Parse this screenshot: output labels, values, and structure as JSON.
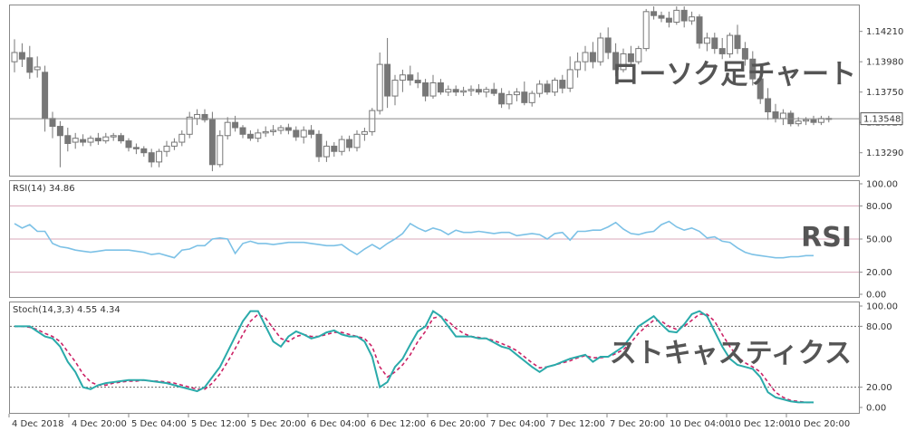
{
  "chart_data": [
    {
      "type": "candlestick",
      "overlay_label": "ローソク足チャート",
      "y_ticks": [
        "1.14210",
        "1.13980",
        "1.13750",
        "1.13520",
        "1.13290"
      ],
      "ylim": [
        1.1313,
        1.144
      ],
      "current_price": "1.13548",
      "current_price_value": 1.13548,
      "candles": [
        {
          "o": 1.1398,
          "h": 1.1415,
          "l": 1.139,
          "c": 1.1405
        },
        {
          "o": 1.1405,
          "h": 1.1412,
          "l": 1.1394,
          "c": 1.14
        },
        {
          "o": 1.1401,
          "h": 1.141,
          "l": 1.1385,
          "c": 1.139
        },
        {
          "o": 1.1392,
          "h": 1.1402,
          "l": 1.1386,
          "c": 1.1394
        },
        {
          "o": 1.139,
          "h": 1.1395,
          "l": 1.1345,
          "c": 1.1355
        },
        {
          "o": 1.1355,
          "h": 1.136,
          "l": 1.134,
          "c": 1.1349
        },
        {
          "o": 1.1349,
          "h": 1.1353,
          "l": 1.1318,
          "c": 1.1342
        },
        {
          "o": 1.1342,
          "h": 1.1348,
          "l": 1.133,
          "c": 1.1336
        },
        {
          "o": 1.1337,
          "h": 1.1344,
          "l": 1.1332,
          "c": 1.134
        },
        {
          "o": 1.1339,
          "h": 1.1343,
          "l": 1.1334,
          "c": 1.1337
        },
        {
          "o": 1.1337,
          "h": 1.1342,
          "l": 1.1334,
          "c": 1.134
        },
        {
          "o": 1.134,
          "h": 1.1344,
          "l": 1.1335,
          "c": 1.1338
        },
        {
          "o": 1.1338,
          "h": 1.1344,
          "l": 1.1336,
          "c": 1.1341
        },
        {
          "o": 1.1341,
          "h": 1.1344,
          "l": 1.1338,
          "c": 1.1342
        },
        {
          "o": 1.1342,
          "h": 1.1344,
          "l": 1.1336,
          "c": 1.1338
        },
        {
          "o": 1.1338,
          "h": 1.134,
          "l": 1.133,
          "c": 1.1333
        },
        {
          "o": 1.1333,
          "h": 1.1336,
          "l": 1.1328,
          "c": 1.1332
        },
        {
          "o": 1.1332,
          "h": 1.1334,
          "l": 1.1326,
          "c": 1.1329
        },
        {
          "o": 1.1329,
          "h": 1.1332,
          "l": 1.1318,
          "c": 1.1322
        },
        {
          "o": 1.1322,
          "h": 1.1332,
          "l": 1.1318,
          "c": 1.133
        },
        {
          "o": 1.133,
          "h": 1.1338,
          "l": 1.1326,
          "c": 1.1334
        },
        {
          "o": 1.1334,
          "h": 1.134,
          "l": 1.1331,
          "c": 1.1337
        },
        {
          "o": 1.1337,
          "h": 1.1346,
          "l": 1.1334,
          "c": 1.1343
        },
        {
          "o": 1.1343,
          "h": 1.136,
          "l": 1.134,
          "c": 1.1356
        },
        {
          "o": 1.1355,
          "h": 1.1362,
          "l": 1.135,
          "c": 1.1358
        },
        {
          "o": 1.1358,
          "h": 1.1362,
          "l": 1.1352,
          "c": 1.1354
        },
        {
          "o": 1.1354,
          "h": 1.136,
          "l": 1.1315,
          "c": 1.132
        },
        {
          "o": 1.132,
          "h": 1.1346,
          "l": 1.1318,
          "c": 1.1342
        },
        {
          "o": 1.1342,
          "h": 1.1356,
          "l": 1.1339,
          "c": 1.1352
        },
        {
          "o": 1.1352,
          "h": 1.1357,
          "l": 1.1345,
          "c": 1.1348
        },
        {
          "o": 1.1348,
          "h": 1.135,
          "l": 1.134,
          "c": 1.1343
        },
        {
          "o": 1.1343,
          "h": 1.1346,
          "l": 1.1338,
          "c": 1.134
        },
        {
          "o": 1.134,
          "h": 1.1347,
          "l": 1.1337,
          "c": 1.1344
        },
        {
          "o": 1.1344,
          "h": 1.1349,
          "l": 1.1341,
          "c": 1.1345
        },
        {
          "o": 1.1345,
          "h": 1.135,
          "l": 1.1342,
          "c": 1.1346
        },
        {
          "o": 1.1346,
          "h": 1.135,
          "l": 1.1343,
          "c": 1.1348
        },
        {
          "o": 1.1348,
          "h": 1.1351,
          "l": 1.1343,
          "c": 1.1346
        },
        {
          "o": 1.1346,
          "h": 1.1349,
          "l": 1.1338,
          "c": 1.1341
        },
        {
          "o": 1.1341,
          "h": 1.1349,
          "l": 1.1336,
          "c": 1.1346
        },
        {
          "o": 1.1346,
          "h": 1.135,
          "l": 1.134,
          "c": 1.1343
        },
        {
          "o": 1.1343,
          "h": 1.1346,
          "l": 1.1322,
          "c": 1.1326
        },
        {
          "o": 1.1326,
          "h": 1.1338,
          "l": 1.1322,
          "c": 1.1334
        },
        {
          "o": 1.1334,
          "h": 1.1337,
          "l": 1.1326,
          "c": 1.133
        },
        {
          "o": 1.133,
          "h": 1.1342,
          "l": 1.1327,
          "c": 1.1339
        },
        {
          "o": 1.1339,
          "h": 1.1342,
          "l": 1.133,
          "c": 1.1333
        },
        {
          "o": 1.1333,
          "h": 1.1346,
          "l": 1.133,
          "c": 1.1343
        },
        {
          "o": 1.1343,
          "h": 1.1348,
          "l": 1.1338,
          "c": 1.1345
        },
        {
          "o": 1.1345,
          "h": 1.1363,
          "l": 1.1342,
          "c": 1.1361
        },
        {
          "o": 1.1361,
          "h": 1.1405,
          "l": 1.1358,
          "c": 1.1396
        },
        {
          "o": 1.1396,
          "h": 1.1416,
          "l": 1.1363,
          "c": 1.1372
        },
        {
          "o": 1.1372,
          "h": 1.1388,
          "l": 1.1365,
          "c": 1.1384
        },
        {
          "o": 1.1384,
          "h": 1.1392,
          "l": 1.1375,
          "c": 1.1388
        },
        {
          "o": 1.1388,
          "h": 1.1395,
          "l": 1.138,
          "c": 1.1384
        },
        {
          "o": 1.1384,
          "h": 1.139,
          "l": 1.1378,
          "c": 1.1382
        },
        {
          "o": 1.1382,
          "h": 1.1385,
          "l": 1.1368,
          "c": 1.1372
        },
        {
          "o": 1.1372,
          "h": 1.1388,
          "l": 1.137,
          "c": 1.1382
        },
        {
          "o": 1.1382,
          "h": 1.1385,
          "l": 1.1373,
          "c": 1.1375
        },
        {
          "o": 1.1375,
          "h": 1.138,
          "l": 1.1372,
          "c": 1.1377
        },
        {
          "o": 1.1377,
          "h": 1.138,
          "l": 1.1372,
          "c": 1.1375
        },
        {
          "o": 1.1375,
          "h": 1.1379,
          "l": 1.1372,
          "c": 1.1376
        },
        {
          "o": 1.1376,
          "h": 1.138,
          "l": 1.1372,
          "c": 1.1377
        },
        {
          "o": 1.1377,
          "h": 1.1381,
          "l": 1.1373,
          "c": 1.1375
        },
        {
          "o": 1.1375,
          "h": 1.1379,
          "l": 1.1371,
          "c": 1.1377
        },
        {
          "o": 1.1377,
          "h": 1.1382,
          "l": 1.1372,
          "c": 1.1374
        },
        {
          "o": 1.1374,
          "h": 1.1378,
          "l": 1.1363,
          "c": 1.1366
        },
        {
          "o": 1.1366,
          "h": 1.1376,
          "l": 1.1362,
          "c": 1.1373
        },
        {
          "o": 1.1373,
          "h": 1.1378,
          "l": 1.1368,
          "c": 1.1375
        },
        {
          "o": 1.1375,
          "h": 1.1383,
          "l": 1.1365,
          "c": 1.1367
        },
        {
          "o": 1.1367,
          "h": 1.1376,
          "l": 1.1364,
          "c": 1.1374
        },
        {
          "o": 1.1374,
          "h": 1.1384,
          "l": 1.1371,
          "c": 1.1381
        },
        {
          "o": 1.1381,
          "h": 1.1384,
          "l": 1.1373,
          "c": 1.1375
        },
        {
          "o": 1.1375,
          "h": 1.1386,
          "l": 1.1372,
          "c": 1.1384
        },
        {
          "o": 1.1384,
          "h": 1.1388,
          "l": 1.1374,
          "c": 1.1378
        },
        {
          "o": 1.1378,
          "h": 1.1402,
          "l": 1.1375,
          "c": 1.1392
        },
        {
          "o": 1.1392,
          "h": 1.1405,
          "l": 1.1386,
          "c": 1.1398
        },
        {
          "o": 1.1398,
          "h": 1.141,
          "l": 1.1391,
          "c": 1.1405
        },
        {
          "o": 1.1405,
          "h": 1.1413,
          "l": 1.1393,
          "c": 1.1398
        },
        {
          "o": 1.1398,
          "h": 1.142,
          "l": 1.1395,
          "c": 1.1416
        },
        {
          "o": 1.1416,
          "h": 1.1424,
          "l": 1.14,
          "c": 1.1405
        },
        {
          "o": 1.1405,
          "h": 1.1412,
          "l": 1.1387,
          "c": 1.1392
        },
        {
          "o": 1.1392,
          "h": 1.1408,
          "l": 1.139,
          "c": 1.1404
        },
        {
          "o": 1.1404,
          "h": 1.141,
          "l": 1.1394,
          "c": 1.1398
        },
        {
          "o": 1.1398,
          "h": 1.141,
          "l": 1.1396,
          "c": 1.1408
        },
        {
          "o": 1.1408,
          "h": 1.1438,
          "l": 1.1406,
          "c": 1.1436
        },
        {
          "o": 1.1436,
          "h": 1.144,
          "l": 1.143,
          "c": 1.1433
        },
        {
          "o": 1.1433,
          "h": 1.1436,
          "l": 1.1428,
          "c": 1.1431
        },
        {
          "o": 1.1431,
          "h": 1.1436,
          "l": 1.1424,
          "c": 1.1428
        },
        {
          "o": 1.1428,
          "h": 1.144,
          "l": 1.1426,
          "c": 1.1437
        },
        {
          "o": 1.1437,
          "h": 1.144,
          "l": 1.1424,
          "c": 1.1429
        },
        {
          "o": 1.1429,
          "h": 1.1436,
          "l": 1.1426,
          "c": 1.1432
        },
        {
          "o": 1.1432,
          "h": 1.1434,
          "l": 1.1408,
          "c": 1.1412
        },
        {
          "o": 1.1412,
          "h": 1.142,
          "l": 1.1406,
          "c": 1.1416
        },
        {
          "o": 1.1416,
          "h": 1.142,
          "l": 1.1404,
          "c": 1.1408
        },
        {
          "o": 1.1408,
          "h": 1.1416,
          "l": 1.14,
          "c": 1.1404
        },
        {
          "o": 1.1404,
          "h": 1.142,
          "l": 1.1401,
          "c": 1.1418
        },
        {
          "o": 1.1418,
          "h": 1.1426,
          "l": 1.1404,
          "c": 1.1408
        },
        {
          "o": 1.1408,
          "h": 1.1413,
          "l": 1.1395,
          "c": 1.14
        },
        {
          "o": 1.14,
          "h": 1.1406,
          "l": 1.138,
          "c": 1.1385
        },
        {
          "o": 1.1385,
          "h": 1.139,
          "l": 1.1366,
          "c": 1.137
        },
        {
          "o": 1.137,
          "h": 1.1378,
          "l": 1.1354,
          "c": 1.136
        },
        {
          "o": 1.136,
          "h": 1.1366,
          "l": 1.1352,
          "c": 1.1355
        },
        {
          "o": 1.1355,
          "h": 1.1362,
          "l": 1.135,
          "c": 1.1359
        },
        {
          "o": 1.1359,
          "h": 1.1361,
          "l": 1.1349,
          "c": 1.1351
        },
        {
          "o": 1.1351,
          "h": 1.1356,
          "l": 1.1349,
          "c": 1.1353
        },
        {
          "o": 1.1353,
          "h": 1.1356,
          "l": 1.135,
          "c": 1.1354
        },
        {
          "o": 1.1354,
          "h": 1.1357,
          "l": 1.135,
          "c": 1.1352
        },
        {
          "o": 1.1352,
          "h": 1.1357,
          "l": 1.135,
          "c": 1.1355
        },
        {
          "o": 1.1355,
          "h": 1.1357,
          "l": 1.1352,
          "c": 1.1355
        }
      ]
    },
    {
      "type": "line",
      "indicator_label": "RSI(14) 34.86",
      "overlay_label": "RSI",
      "ylim": [
        0,
        100
      ],
      "y_ticks": [
        "100.00",
        "80.00",
        "50.00",
        "20.00",
        "0.00"
      ],
      "levels": [
        80,
        50,
        20
      ],
      "series": [
        {
          "values": [
            64,
            60,
            63,
            57,
            57,
            46,
            43,
            42,
            40,
            39,
            38,
            39,
            40,
            40,
            40,
            40,
            39,
            38,
            36,
            37,
            35,
            33,
            40,
            41,
            44,
            44,
            50,
            51,
            50,
            37,
            46,
            48,
            46,
            46,
            45,
            46,
            47,
            47,
            47,
            46,
            45,
            44,
            44,
            45,
            40,
            36,
            41,
            45,
            41,
            46,
            50,
            55,
            64,
            60,
            57,
            60,
            58,
            54,
            58,
            56,
            56,
            57,
            56,
            55,
            56,
            56,
            53,
            54,
            55,
            54,
            50,
            55,
            56,
            49,
            57,
            57,
            58,
            58,
            61,
            65,
            59,
            55,
            54,
            56,
            57,
            63,
            66,
            61,
            58,
            60,
            57,
            51,
            52,
            48,
            47,
            42,
            38,
            36,
            35,
            34,
            33,
            33,
            34,
            34,
            35,
            35
          ]
        }
      ]
    },
    {
      "type": "line",
      "indicator_label": "Stoch(14,3,3) 4.55 4.34",
      "overlay_label": "ストキャスティクス",
      "ylim": [
        0,
        100
      ],
      "y_ticks": [
        "100.00",
        "80.00",
        "20.00",
        "0.00"
      ],
      "levels": [
        80,
        20
      ],
      "series": [
        {
          "values": [
            80,
            80,
            80,
            75,
            70,
            68,
            60,
            45,
            35,
            20,
            18,
            22,
            24,
            25,
            26,
            27,
            27,
            27,
            26,
            25,
            24,
            22,
            20,
            18,
            16,
            20,
            30,
            40,
            55,
            70,
            85,
            95,
            95,
            80,
            65,
            60,
            70,
            75,
            72,
            68,
            70,
            74,
            76,
            72,
            70,
            70,
            65,
            50,
            20,
            25,
            40,
            48,
            62,
            75,
            80,
            95,
            90,
            80,
            70,
            70,
            70,
            68,
            68,
            64,
            60,
            58,
            52,
            46,
            40,
            35,
            40,
            42,
            45,
            48,
            50,
            52,
            45,
            50,
            50,
            55,
            60,
            70,
            80,
            85,
            90,
            82,
            75,
            74,
            82,
            92,
            95,
            90,
            75,
            60,
            48,
            42,
            40,
            38,
            30,
            15,
            10,
            8,
            6,
            5,
            5,
            5
          ]
        },
        {
          "values": [
            80,
            80,
            79,
            77,
            73,
            70,
            65,
            55,
            45,
            33,
            25,
            22,
            22,
            24,
            25,
            26,
            26,
            27,
            26,
            26,
            25,
            24,
            22,
            20,
            18,
            18,
            24,
            33,
            45,
            58,
            72,
            85,
            92,
            88,
            78,
            68,
            65,
            70,
            72,
            70,
            70,
            72,
            74,
            74,
            72,
            70,
            68,
            60,
            40,
            30,
            35,
            42,
            52,
            65,
            75,
            88,
            90,
            85,
            78,
            73,
            70,
            69,
            68,
            66,
            63,
            60,
            56,
            50,
            44,
            39,
            40,
            42,
            44,
            46,
            49,
            51,
            49,
            49,
            50,
            53,
            57,
            64,
            73,
            80,
            86,
            85,
            80,
            77,
            80,
            86,
            92,
            92,
            85,
            72,
            60,
            50,
            44,
            40,
            35,
            25,
            15,
            10,
            7,
            6,
            5,
            5
          ]
        }
      ]
    }
  ],
  "x_labels": [
    "4 Dec 2018",
    "4 Dec 20:00",
    "5 Dec 04:00",
    "5 Dec 12:00",
    "5 Dec 20:00",
    "6 Dec 04:00",
    "6 Dec 12:00",
    "6 Dec 20:00",
    "7 Dec 04:00",
    "7 Dec 12:00",
    "7 Dec 20:00",
    "10 Dec 04:00",
    "10 Dec 12:00",
    "10 Dec 20:00"
  ],
  "colors": {
    "candle": "#777777",
    "rsi": "#7cc1e6",
    "stoch_main": "#2aaaaa",
    "stoch_signal": "#cc2266",
    "level_rsi": "#d9a7b9"
  }
}
